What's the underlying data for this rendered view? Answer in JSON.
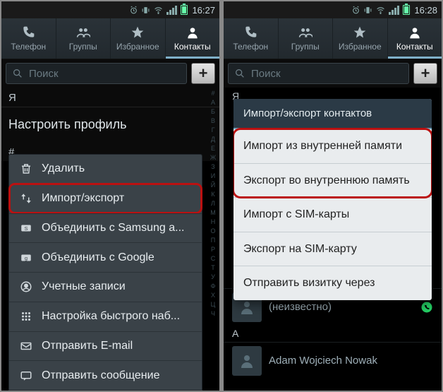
{
  "left": {
    "status": {
      "time": "16:27"
    },
    "tabs": {
      "phone": "Телефон",
      "groups": "Группы",
      "fav": "Избранное",
      "contacts": "Контакты"
    },
    "search_placeholder": "Поиск",
    "add_label": "+",
    "section_me": "Я",
    "profile_setup": "Настроить профиль",
    "section_hash": "#",
    "alpha": "#АБВГДЕЖЗИЙКЛМНОПРСТУФХЦЧ",
    "menu": {
      "delete": "Удалить",
      "import_export": "Импорт/экспорт",
      "merge_samsung": "Объединить с Samsung а...",
      "merge_google": "Объединить с Google",
      "accounts": "Учетные записи",
      "speed_dial": "Настройка быстрого наб...",
      "send_email": "Отправить E-mail",
      "send_message": "Отправить сообщение"
    }
  },
  "right": {
    "status": {
      "time": "16:28"
    },
    "tabs": {
      "phone": "Телефон",
      "groups": "Группы",
      "fav": "Избранное",
      "contacts": "Контакты"
    },
    "search_placeholder": "Поиск",
    "add_label": "+",
    "section_me": "Я",
    "bg_unknown": "(неизвестно)",
    "bg_section_a": "A",
    "bg_name_1": "Adam Wojciech Nowak",
    "dialog": {
      "title": "Импорт/экспорт контактов",
      "import_internal": "Импорт из внутренней памяти",
      "export_internal": "Экспорт во внутреннюю память",
      "import_sim": "Импорт с SIM-карты",
      "export_sim": "Экспорт на SIM-карту",
      "send_vcard": "Отправить визитку через"
    }
  }
}
